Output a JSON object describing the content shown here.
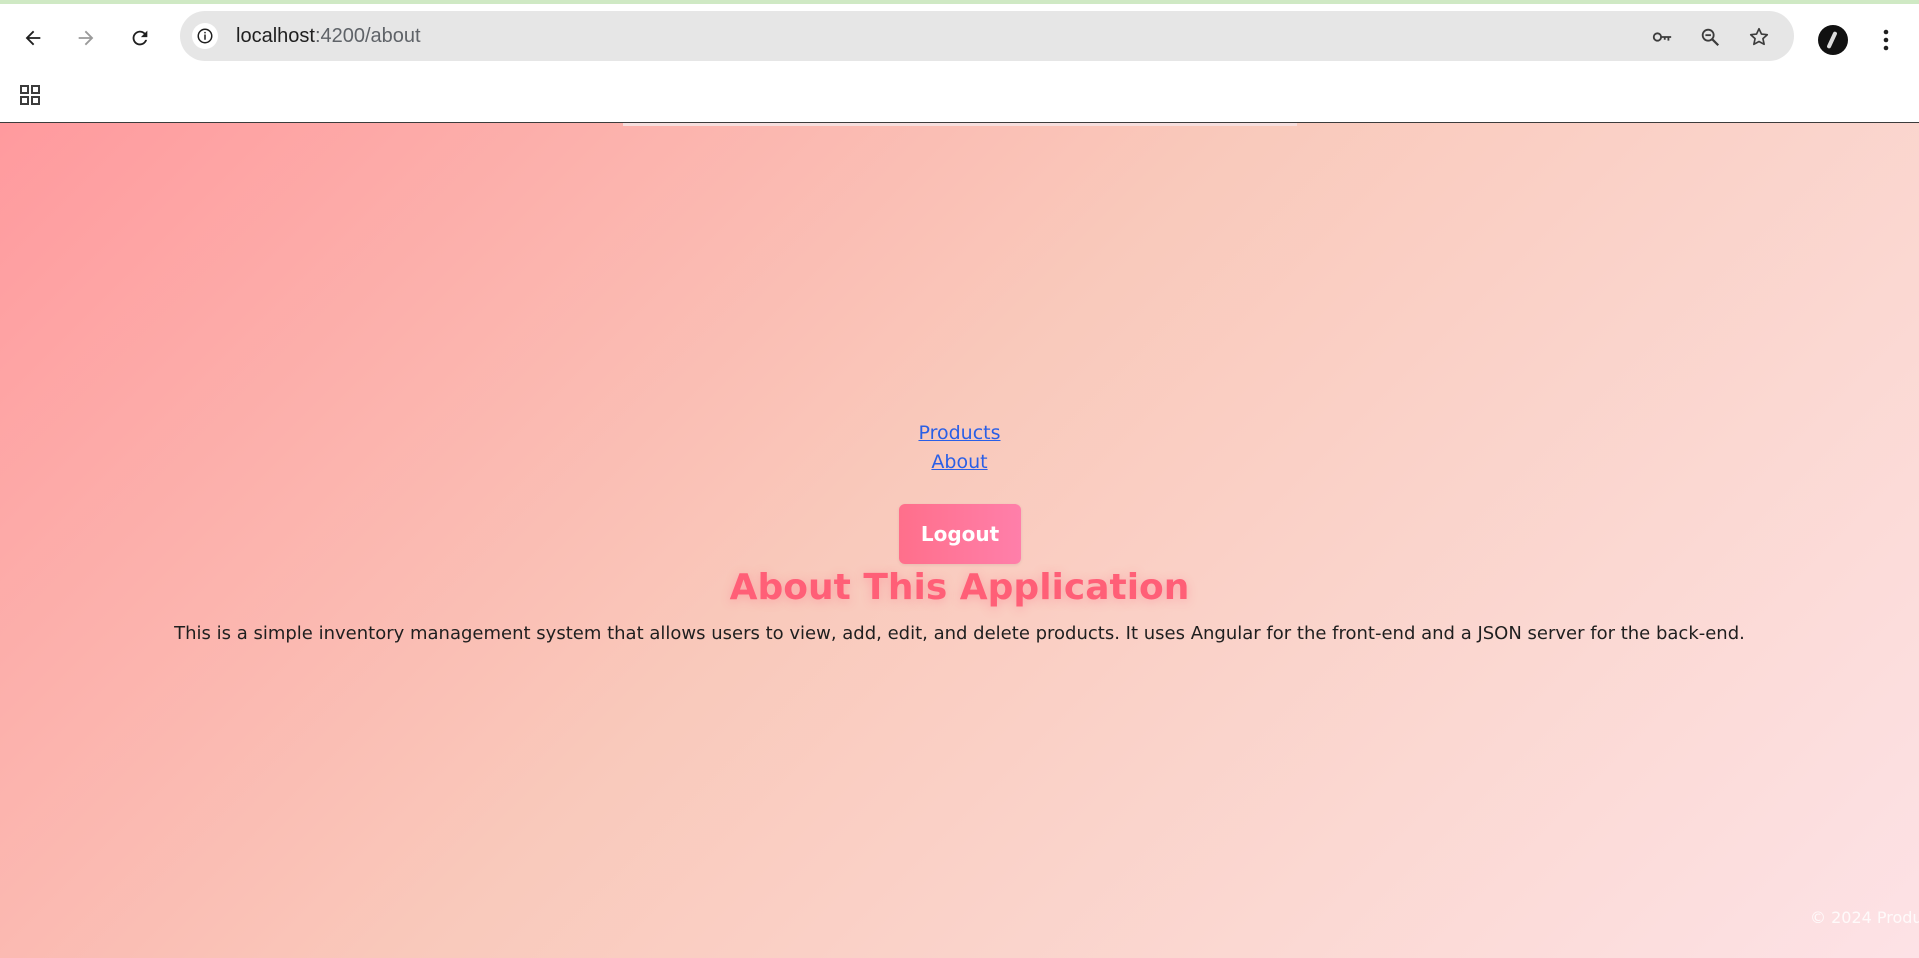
{
  "browser": {
    "url_host": "localhost",
    "url_rest": ":4200/about",
    "icons": {
      "back": "back-arrow-icon",
      "forward": "forward-arrow-icon",
      "reload": "reload-icon",
      "site_info": "info-icon",
      "password": "key-icon",
      "zoom": "zoom-out-icon",
      "bookmark": "star-icon",
      "menu": "kebab-menu-icon",
      "apps": "apps-grid-icon"
    }
  },
  "nav": {
    "links": [
      "Products",
      "About"
    ]
  },
  "auth": {
    "logout_label": "Logout"
  },
  "page": {
    "title": "About This Application",
    "description": "This is a simple inventory management system that allows users to view, add, edit, and delete products. It uses Angular for the front-end and a JSON server for the back-end."
  },
  "footer": {
    "text": "© 2024 Produ"
  },
  "colors": {
    "title": "#ff5f77",
    "link": "#2a5fe6",
    "button": "#ff6f8b",
    "gradient_start": "#ff9a9e",
    "gradient_end": "#fde2e6"
  }
}
